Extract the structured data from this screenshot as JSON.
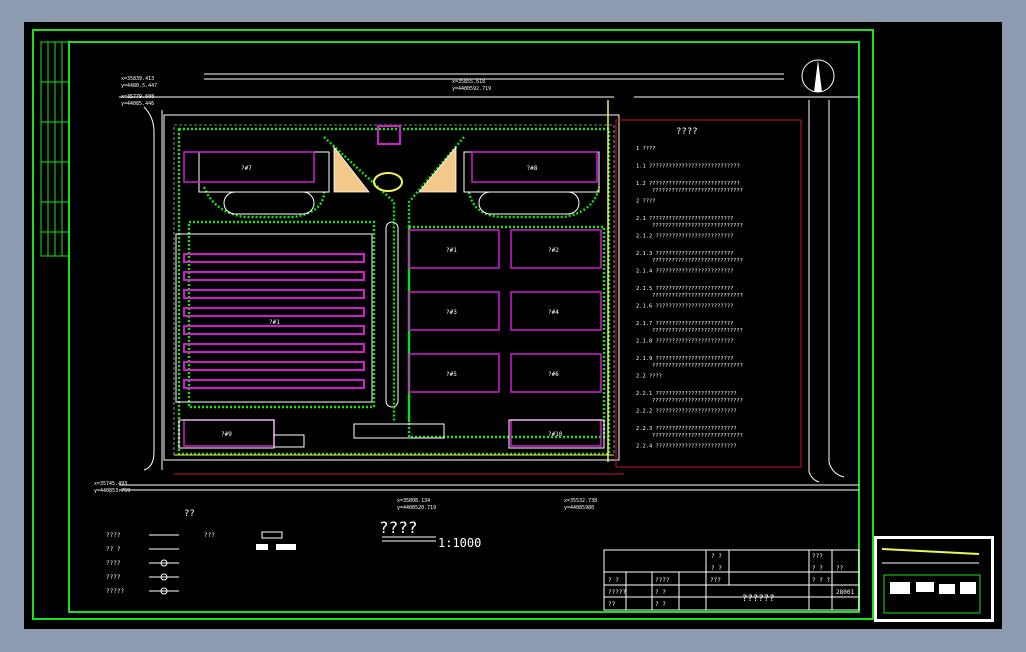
{
  "sheet": {
    "plan_title": "????",
    "scale": "1:1000",
    "notes_title": "????",
    "legend_title": "??"
  },
  "coords": [
    {
      "x": "x=35839.413",
      "y": "y=4480.5.447"
    },
    {
      "x": "x=35779.608",
      "y": "y=44085.446"
    },
    {
      "x": "x=35855.618",
      "y": "y=4480592.719"
    },
    {
      "x": "x=35745.493",
      "y": "y=440853.759"
    },
    {
      "x": "x=35808.134",
      "y": "y=4408520.719"
    },
    {
      "x": "x=35532.738",
      "y": "y=44085980"
    }
  ],
  "building_labels": [
    "?#1",
    "?#2",
    "?#3",
    "?#4",
    "?#5",
    "?#6",
    "?#7",
    "?#8",
    "?#9",
    "?#10"
  ],
  "notes": [
    "1 ????",
    "1.1 ????????????????????????????",
    "1.2 ????????????????????????????",
    "2 ????",
    "2.1 ??????????????????????????",
    "2.1.2 ????????????????????????",
    "2.1.3 ????????????????????????",
    "2.1.4 ????????????????????????",
    "2.1.5 ????????????????????????",
    "2.1.6 ????????????????????????",
    "2.1.7 ????????????????????????",
    "2.1.8 ????????????????????????",
    "2.1.9 ????????????????????????",
    "2.2 ????",
    "2.2.1 ?????????????????????????",
    "2.2.2 ?????????????????????????",
    "2.2.3 ?????????????????????????",
    "2.2.4 ?????????????????????????"
  ],
  "legend": [
    {
      "label": "????",
      "label2": "???"
    },
    {
      "label": "?? ?"
    },
    {
      "label": "????"
    },
    {
      "label": "????"
    },
    {
      "label": "?????"
    }
  ],
  "title_block": {
    "c1": "? ?",
    "c2": "? ?",
    "c3": "???",
    "c4": "? ?",
    "c5": "? ?",
    "c6": "????",
    "c7": "???",
    "c8": "??",
    "c9": "?????",
    "c10": "? ?",
    "c11": "? ? ?",
    "c12": "? ?",
    "c13": "??",
    "drawing_name": "??????",
    "drawing_no": "28001"
  },
  "colors": {
    "frame": "#17e017",
    "road": "#ffffff",
    "building": "#d21ad2",
    "accent": "#f3f354",
    "notes_border": "#c8162a"
  }
}
